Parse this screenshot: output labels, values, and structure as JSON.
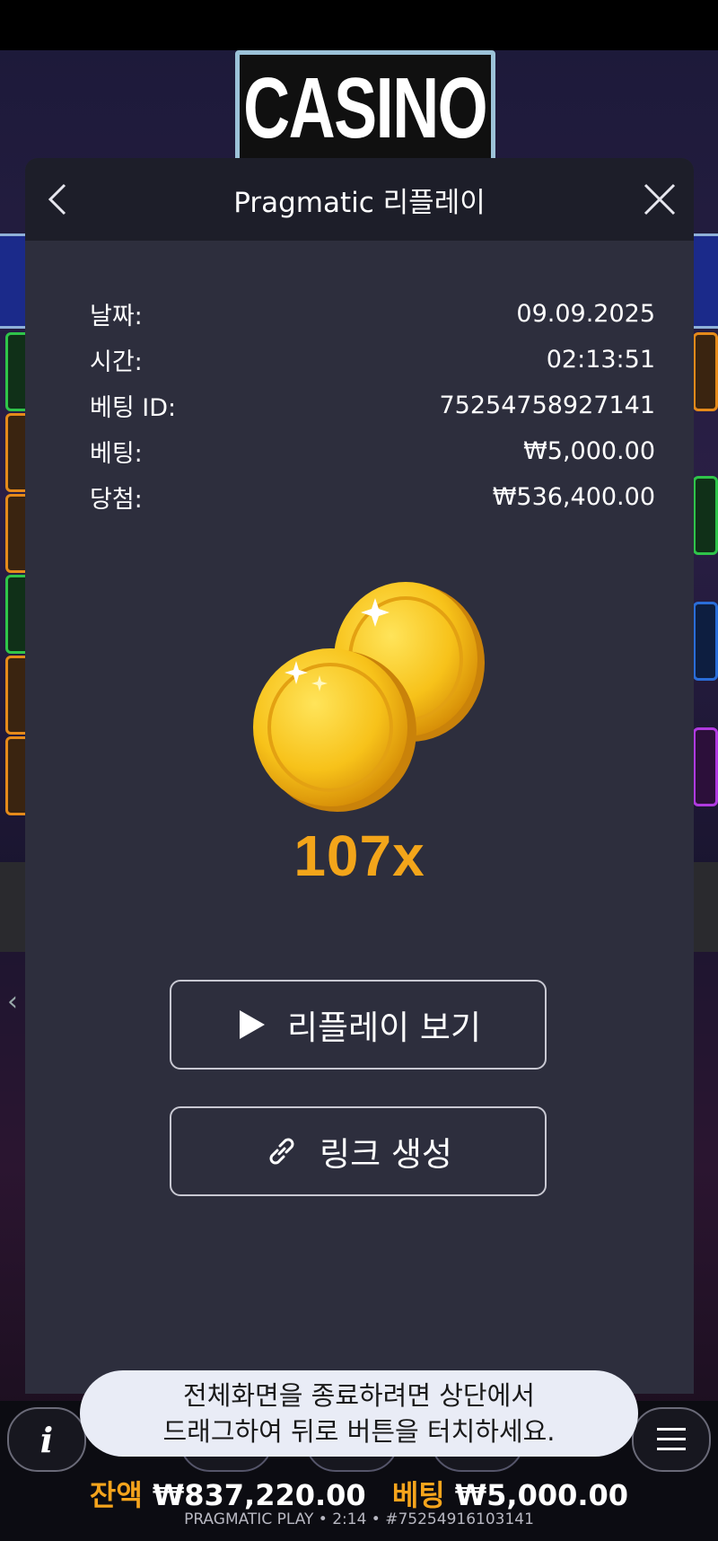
{
  "background": {
    "sign_text": "CASINO"
  },
  "modal": {
    "title": "Pragmatic 리플레이",
    "back_icon": "chevron-left-icon",
    "close_icon": "close-icon",
    "info_rows": [
      {
        "label": "날짜:",
        "value": "09.09.2025"
      },
      {
        "label": "시간:",
        "value": "02:13:51"
      },
      {
        "label": "베팅 ID:",
        "value": "75254758927141"
      },
      {
        "label": "베팅:",
        "value": "₩5,000.00"
      },
      {
        "label": "당첨:",
        "value": "₩536,400.00"
      }
    ],
    "multiplier": "107x",
    "replay_button": "리플레이 보기",
    "link_button": "링크 생성"
  },
  "toast": {
    "line1": "전체화면을 종료하려면 상단에서",
    "line2": "드래그하여 뒤로 버튼을 터치하세요."
  },
  "hud": {
    "info_glyph": "i",
    "balance_label": "잔액",
    "balance_value": "₩837,220.00",
    "bet_label": "베팅",
    "bet_value": "₩5,000.00",
    "footer": "PRAGMATIC PLAY • 2:14 • #75254916103141"
  },
  "colors": {
    "accent_gold": "#f5a41c",
    "modal_bg": "#2d2e3d",
    "header_bg": "#1d1e29"
  }
}
